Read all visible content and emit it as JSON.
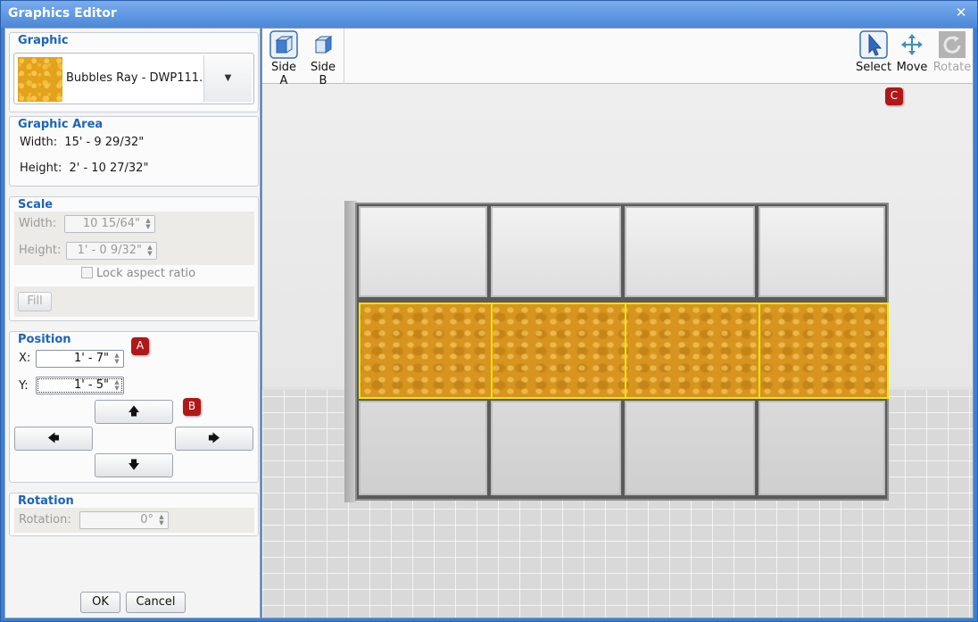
{
  "window": {
    "title": "Graphics Editor",
    "close_glyph": "✕"
  },
  "graphic": {
    "title": "Graphic",
    "selected": "Bubbles Ray - DWP111...",
    "swatch_color": "#e2a21c",
    "dropdown_icon": "chevron-down-icon"
  },
  "graphic_area": {
    "title": "Graphic Area",
    "width_label": "Width:",
    "width_value": "15' - 9 29/32\"",
    "height_label": "Height:",
    "height_value": "2' - 10 27/32\""
  },
  "scale": {
    "title": "Scale",
    "width_label": "Width:",
    "width_value": "10 15/64\"",
    "height_label": "Height:",
    "height_value": "1' - 0 9/32\"",
    "lock_label": "Lock aspect ratio",
    "fill_label": "Fill"
  },
  "position": {
    "title": "Position",
    "x_label": "X:",
    "x_value": "1' - 7\"",
    "y_label": "Y:",
    "y_value": "1' - 5\""
  },
  "rotation": {
    "title": "Rotation",
    "label": "Rotation:",
    "value": "0°"
  },
  "dialog_buttons": {
    "ok": "OK",
    "cancel": "Cancel"
  },
  "badges": {
    "a": "A",
    "b": "B",
    "c": "C",
    "color": "#b01818"
  },
  "toolbar": {
    "side_a": "Side A",
    "side_b": "Side B",
    "select": "Select",
    "move": "Move",
    "rotate": "Rotate"
  },
  "colors": {
    "accent": "#1c64b8",
    "title_bar": "#4b88d8",
    "graphic_outline": "#f2e400"
  }
}
